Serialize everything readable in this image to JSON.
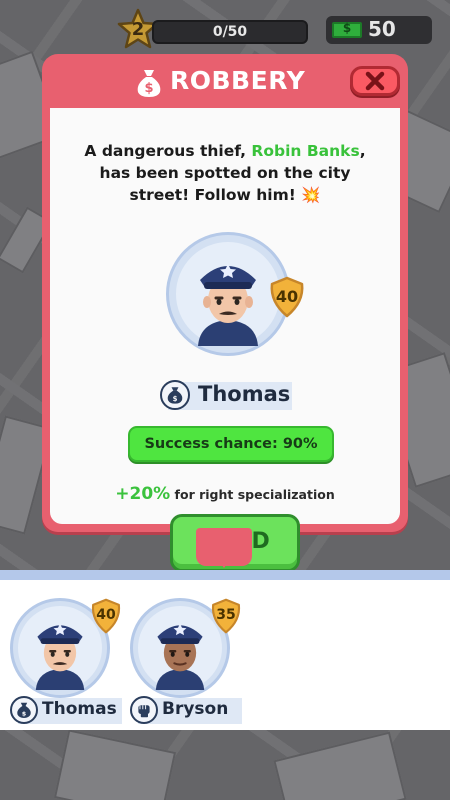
{
  "hud": {
    "level": "2",
    "progress_text": "0/50",
    "progress_fraction": 0,
    "cash": "50"
  },
  "dialog": {
    "title": "ROBBERY",
    "message_part1": "A dangerous thief, ",
    "thief_name": "Robin Banks",
    "message_part2": ", has been spotted on the city street! Follow him! 💥",
    "officer_name": "Thomas",
    "officer_level": "40",
    "success_chance": "Success chance: 90%",
    "bonus_value": "+20%",
    "bonus_text": " for right specialization",
    "send_label": "SEND"
  },
  "roster": [
    {
      "name": "Thomas",
      "level": "40",
      "specialization": "money-bag-icon",
      "skin": "#f2c6a8"
    },
    {
      "name": "Bryson",
      "level": "35",
      "specialization": "fist-icon",
      "skin": "#a87456"
    }
  ],
  "colors": {
    "dialog_red": "#e8606f",
    "success_green": "#4fe540",
    "highlight_green": "#39c23b",
    "badge_gold": "#f2b23a"
  }
}
